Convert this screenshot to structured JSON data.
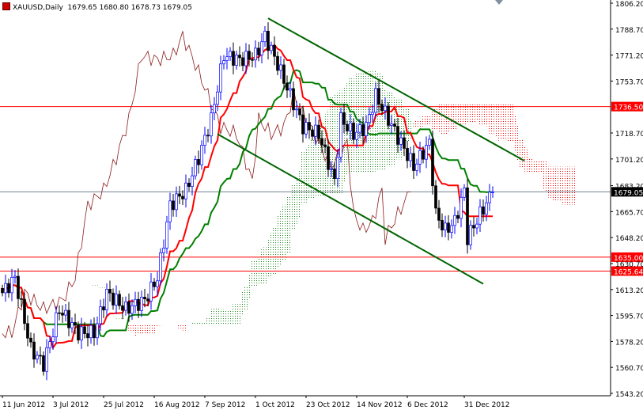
{
  "header": {
    "symbol": "XAUUSD,Daily",
    "open": "1679.65",
    "high": "1680.80",
    "low": "1678.73",
    "close": "1679.05"
  },
  "chart_data": {
    "type": "candlestick",
    "title": "XAUUSD,Daily",
    "indicators": [
      "Ichimoku Kinko Hyo (Tenkan-sen red, Kijun-sen green, Kumo cloud, Chikou span)"
    ],
    "ylim": [
      1543.2,
      1806.2
    ],
    "y_ticks": [
      "1806.20",
      "1788.70",
      "1771.20",
      "1753.70",
      "1718.70",
      "1701.20",
      "1683.20",
      "1665.70",
      "1648.20",
      "1630.70",
      "1613.20",
      "1595.70",
      "1578.20",
      "1560.70",
      "1543.20"
    ],
    "x_ticks": [
      {
        "bar": 0,
        "label": "11 Jun 2012"
      },
      {
        "bar": 16,
        "label": "3 Jul 2012"
      },
      {
        "bar": 32,
        "label": "25 Jul 2012"
      },
      {
        "bar": 48,
        "label": "16 Aug 2012"
      },
      {
        "bar": 64,
        "label": "7 Sep 2012"
      },
      {
        "bar": 80,
        "label": "1 Oct 2012"
      },
      {
        "bar": 96,
        "label": "23 Oct 2012"
      },
      {
        "bar": 112,
        "label": "14 Nov 2012"
      },
      {
        "bar": 128,
        "label": "6 Dec 2012"
      },
      {
        "bar": 146,
        "label": "31 Dec 2012"
      }
    ],
    "close_keypoints": [
      [
        0,
        1611
      ],
      [
        4,
        1621
      ],
      [
        9,
        1573
      ],
      [
        13,
        1563
      ],
      [
        18,
        1600
      ],
      [
        24,
        1584
      ],
      [
        29,
        1584
      ],
      [
        33,
        1611
      ],
      [
        39,
        1600
      ],
      [
        45,
        1606
      ],
      [
        49,
        1621
      ],
      [
        53,
        1670
      ],
      [
        58,
        1680
      ],
      [
        62,
        1702
      ],
      [
        66,
        1728
      ],
      [
        70,
        1771
      ],
      [
        75,
        1768
      ],
      [
        80,
        1771
      ],
      [
        83,
        1784
      ],
      [
        87,
        1765
      ],
      [
        91,
        1744
      ],
      [
        95,
        1723
      ],
      [
        100,
        1718
      ],
      [
        105,
        1686
      ],
      [
        107,
        1728
      ],
      [
        111,
        1718
      ],
      [
        115,
        1723
      ],
      [
        118,
        1744
      ],
      [
        122,
        1728
      ],
      [
        126,
        1712
      ],
      [
        130,
        1696
      ],
      [
        135,
        1712
      ],
      [
        137,
        1664
      ],
      [
        140,
        1653
      ],
      [
        143,
        1659
      ],
      [
        146,
        1680
      ],
      [
        147,
        1648
      ],
      [
        151,
        1664
      ],
      [
        155,
        1679
      ]
    ],
    "levels": [
      {
        "price": 1736.5,
        "label": "1736.50",
        "color": "#ff0000"
      },
      {
        "price": 1679.05,
        "label": "1679.05",
        "color": "#000000"
      },
      {
        "price": 1635.0,
        "label": "1635.00",
        "color": "#ff0000"
      },
      {
        "price": 1625.64,
        "label": "1625.64",
        "color": "#ff0000"
      }
    ],
    "trendlines": [
      {
        "name": "channel-upper",
        "from": [
          84,
          1796
        ],
        "to": [
          165,
          1700
        ],
        "color": "#006400"
      },
      {
        "name": "channel-lower",
        "from": [
          68,
          1718
        ],
        "to": [
          152,
          1617
        ],
        "color": "#006400"
      }
    ],
    "colors": {
      "bull": "#0000ff",
      "bear": "#000000",
      "tenkan": "#ff0000",
      "kijun": "#008000",
      "chikou": "#8b1a1a",
      "cloud_up": "#228b22",
      "cloud_down": "#ff0000"
    }
  }
}
